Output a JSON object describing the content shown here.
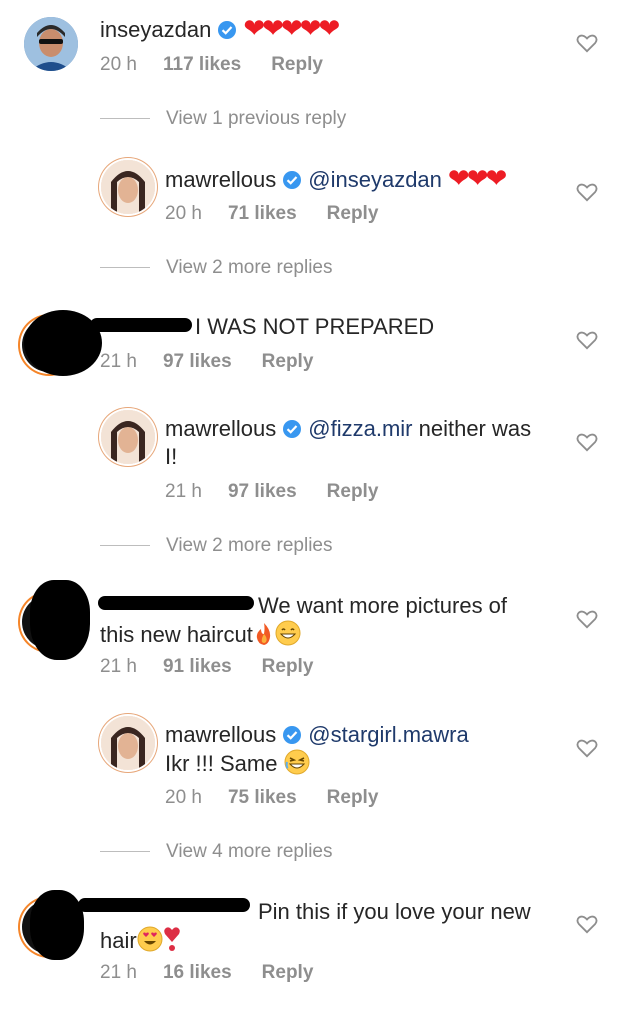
{
  "comments": [
    {
      "user": "inseyazdan",
      "text": "",
      "time": "20 h",
      "likes": "117 likes",
      "reply": "Reply",
      "view_more": "View 1 previous reply"
    },
    {
      "user": "mawrellous",
      "mention": "@inseyazdan",
      "time": "20 h",
      "likes": "71 likes",
      "reply": "Reply",
      "view_more": "View 2 more replies"
    },
    {
      "text": "I WAS NOT PREPARED",
      "time": "21 h",
      "likes": "97 likes",
      "reply": "Reply"
    },
    {
      "user": "mawrellous",
      "mention": "@fizza.mir",
      "text_a": " neither was",
      "text_b": "I!",
      "time": "21 h",
      "likes": "97 likes",
      "reply": "Reply",
      "view_more": "View 2 more replies"
    },
    {
      "text_a": "We want more pictures of",
      "text_b": "this new haircut",
      "time": "21 h",
      "likes": "91 likes",
      "reply": "Reply"
    },
    {
      "user": "mawrellous",
      "mention": "@stargirl.mawra",
      "text_b": "Ikr !!! Same",
      "time": "20 h",
      "likes": "75 likes",
      "reply": "Reply",
      "view_more": "View 4 more replies"
    },
    {
      "text_a": "Pin this if you love your new",
      "text_b": "hair",
      "time": "21 h",
      "likes": "16 likes",
      "reply": "Reply"
    }
  ],
  "colors": {
    "verified": "#3897f0",
    "heart": "#ed1c24",
    "meta": "#8e8e8e"
  }
}
